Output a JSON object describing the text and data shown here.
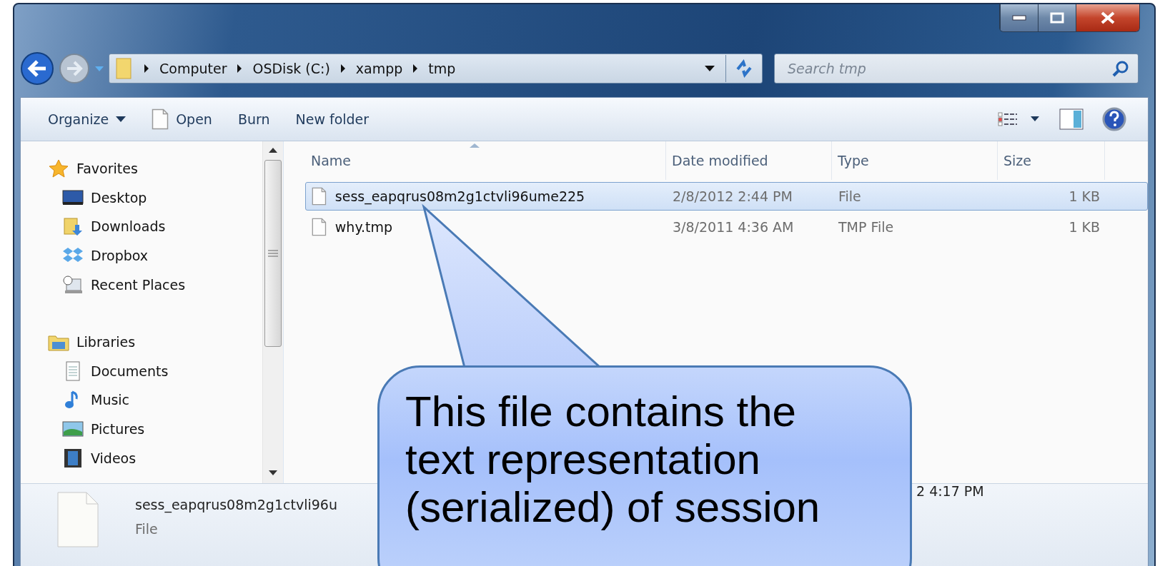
{
  "breadcrumb": [
    "Computer",
    "OSDisk (C:)",
    "xampp",
    "tmp"
  ],
  "search": {
    "placeholder": "Search tmp"
  },
  "toolbar": [
    {
      "label": "Organize",
      "kind": "menu"
    },
    {
      "label": "Open",
      "kind": "file"
    },
    {
      "label": "Burn",
      "kind": "plain"
    },
    {
      "label": "New folder",
      "kind": "plain"
    }
  ],
  "sidebar": [
    {
      "label": "Favorites",
      "kind": "star",
      "children": [
        {
          "label": "Desktop",
          "kind": "desktop"
        },
        {
          "label": "Downloads",
          "kind": "downloads"
        },
        {
          "label": "Dropbox",
          "kind": "dropbox"
        },
        {
          "label": "Recent Places",
          "kind": "recent"
        }
      ]
    },
    {
      "label": "Libraries",
      "kind": "library",
      "children": [
        {
          "label": "Documents",
          "kind": "documents"
        },
        {
          "label": "Music",
          "kind": "music"
        },
        {
          "label": "Pictures",
          "kind": "pictures"
        },
        {
          "label": "Videos",
          "kind": "videos"
        }
      ]
    }
  ],
  "columns": [
    {
      "label": "Name",
      "sorted": true
    },
    {
      "label": "Date modified",
      "sorted": false
    },
    {
      "label": "Type",
      "sorted": false
    },
    {
      "label": "Size",
      "sorted": false
    }
  ],
  "rows": [
    {
      "name": "sess_eapqrus08m2g1ctvli96ume225",
      "date": "2/8/2012 2:44 PM",
      "type": "File",
      "size": "1 KB",
      "selected": true
    },
    {
      "name": "why.tmp",
      "date": "3/8/2011 4:36 AM",
      "type": "TMP File",
      "size": "1 KB",
      "selected": false
    }
  ],
  "details": {
    "name": "sess_eapqrus08m2g1ctvli96u",
    "type": "File",
    "date": "2 4:17 PM"
  },
  "callout": {
    "lines": [
      "This file contains the",
      "text representation",
      "(serialized) of session"
    ]
  }
}
